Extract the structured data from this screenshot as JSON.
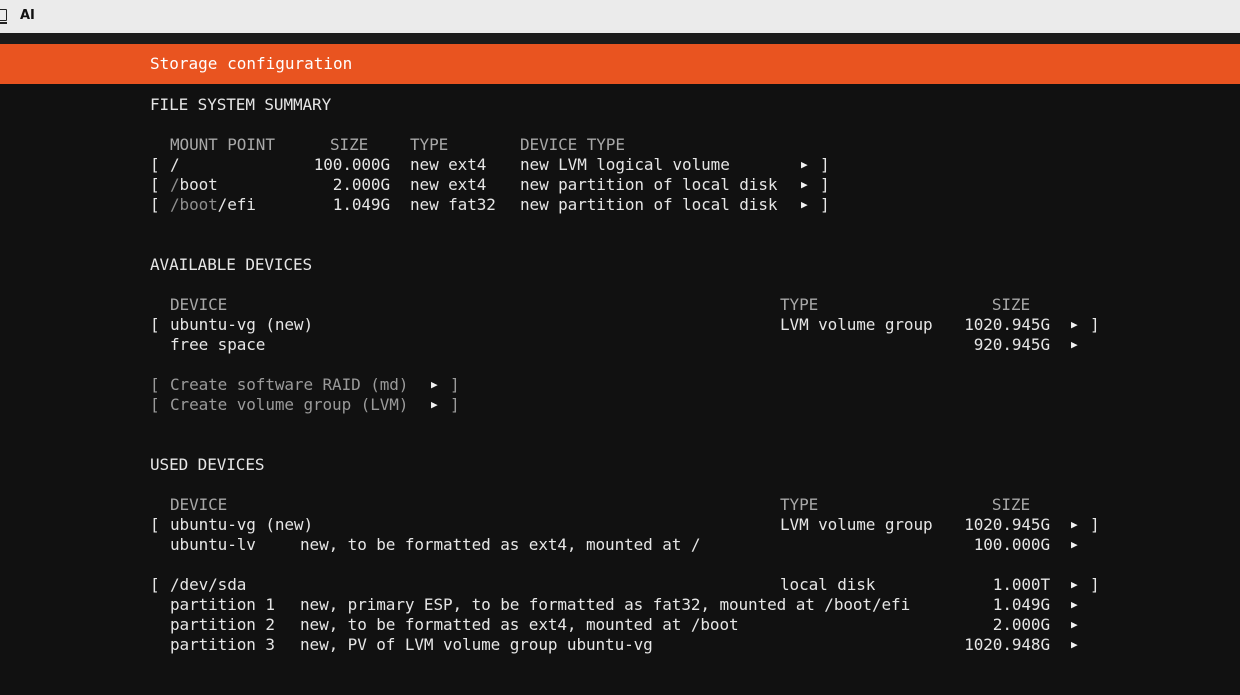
{
  "window": {
    "title": "AI",
    "icon": "terminal-window-icon"
  },
  "header": {
    "title": "Storage configuration"
  },
  "sections": {
    "fs_summary": "FILE SYSTEM SUMMARY",
    "available": "AVAILABLE DEVICES",
    "used": "USED DEVICES"
  },
  "fs": {
    "columns": {
      "mount": "MOUNT POINT",
      "size": "SIZE",
      "type": "TYPE",
      "device_type": "DEVICE TYPE"
    },
    "rows": [
      {
        "mount_prefix": "",
        "mount": "/",
        "size": "100.000G",
        "type": "new ext4",
        "device_type": "new LVM logical volume"
      },
      {
        "mount_prefix": "/",
        "mount": "boot",
        "size": "2.000G",
        "type": "new ext4",
        "device_type": "new partition of local disk"
      },
      {
        "mount_prefix": "/boot",
        "mount": "/efi",
        "size": "1.049G",
        "type": "new fat32",
        "device_type": "new partition of local disk"
      }
    ]
  },
  "available": {
    "columns": {
      "device": "DEVICE",
      "type": "TYPE",
      "size": "SIZE"
    },
    "vg": {
      "name": "ubuntu-vg (new)",
      "type": "LVM volume group",
      "size": "1020.945G"
    },
    "free": {
      "name": "free space",
      "size": "920.945G"
    },
    "actions": {
      "raid": "Create software RAID (md)",
      "lvm": "Create volume group (LVM)"
    }
  },
  "used": {
    "columns": {
      "device": "DEVICE",
      "type": "TYPE",
      "size": "SIZE"
    },
    "vg": {
      "name": "ubuntu-vg (new)",
      "type": "LVM volume group",
      "size": "1020.945G"
    },
    "lv": {
      "name": "ubuntu-lv",
      "desc": "new, to be formatted as ext4, mounted at /",
      "size": "100.000G"
    },
    "disk": {
      "name": "/dev/sda",
      "type": "local disk",
      "size": "1.000T"
    },
    "partitions": [
      {
        "name": "partition 1",
        "desc": "new, primary ESP, to be formatted as fat32, mounted at /boot/efi",
        "size": "1.049G"
      },
      {
        "name": "partition 2",
        "desc": "new, to be formatted as ext4, mounted at /boot",
        "size": "2.000G"
      },
      {
        "name": "partition 3",
        "desc": "new, PV of LVM volume group ubuntu-vg",
        "size": "1020.948G"
      }
    ]
  },
  "glyphs": {
    "open": "[",
    "close": "]",
    "arrow": "▶"
  }
}
